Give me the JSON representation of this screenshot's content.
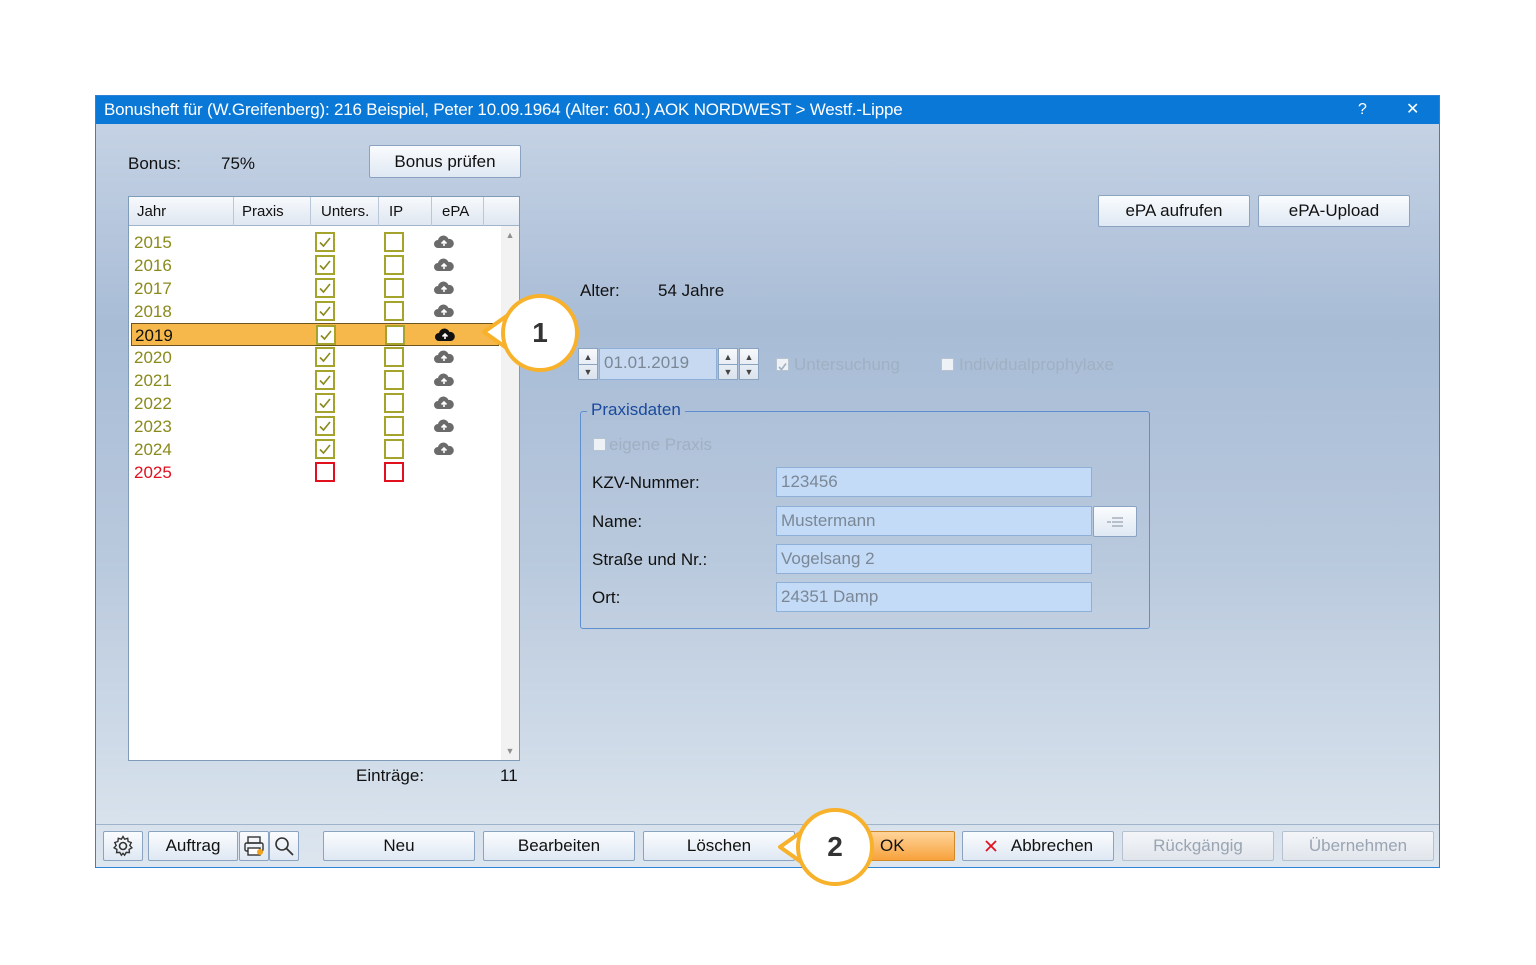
{
  "window": {
    "title": "Bonusheft für (W.Greifenberg): 216  Beispiel, Peter 10.09.1964  (Alter: 60J.)  AOK NORDWEST > Westf.-Lippe",
    "help": "?",
    "close": "✕"
  },
  "bonus": {
    "label": "Bonus:",
    "value": "75%",
    "check_button": "Bonus prüfen"
  },
  "list": {
    "headers": [
      "Jahr",
      "Praxis",
      "Unters.",
      "IP",
      "ePA"
    ],
    "rows": [
      {
        "year": "2015",
        "unters": true,
        "ip": false,
        "epa": true
      },
      {
        "year": "2016",
        "unters": true,
        "ip": false,
        "epa": true
      },
      {
        "year": "2017",
        "unters": true,
        "ip": false,
        "epa": true
      },
      {
        "year": "2018",
        "unters": true,
        "ip": false,
        "epa": true
      },
      {
        "year": "2019",
        "unters": true,
        "ip": false,
        "epa": true,
        "selected": true
      },
      {
        "year": "2020",
        "unters": true,
        "ip": false,
        "epa": true
      },
      {
        "year": "2021",
        "unters": true,
        "ip": false,
        "epa": true
      },
      {
        "year": "2022",
        "unters": true,
        "ip": false,
        "epa": true
      },
      {
        "year": "2023",
        "unters": true,
        "ip": false,
        "epa": true
      },
      {
        "year": "2024",
        "unters": true,
        "ip": false,
        "epa": true
      },
      {
        "year": "2025",
        "unters": false,
        "ip": false,
        "epa": false,
        "missing": true
      }
    ],
    "entries_label": "Einträge:",
    "entries_count": "11"
  },
  "epa": {
    "open_button": "ePA aufrufen",
    "upload_button": "ePA-Upload"
  },
  "detail": {
    "age_label": "Alter:",
    "age_value": "54 Jahre",
    "date": "01.01.2019",
    "untersuchung_label": "Untersuchung",
    "ip_label": "Individualprophylaxe"
  },
  "praxisdaten": {
    "title": "Praxisdaten",
    "own_practice": "eigene Praxis",
    "kzv_label": "KZV-Nummer:",
    "kzv_value": "123456",
    "name_label": "Name:",
    "name_value": "Mustermann",
    "street_label": "Straße und Nr.:",
    "street_value": "Vogelsang 2",
    "city_label": "Ort:",
    "city_value": "24351 Damp"
  },
  "footer": {
    "auftrag": "Auftrag",
    "neu": "Neu",
    "bearbeiten": "Bearbeiten",
    "loeschen": "Löschen",
    "ok": "OK",
    "abbrechen": "Abbrechen",
    "rueckgaengig": "Rückgängig",
    "uebernehmen": "Übernehmen"
  },
  "callouts": {
    "one": "1",
    "two": "2"
  },
  "colors": {
    "accent": "#0a78d7",
    "selection": "#f7b84b",
    "callout": "#f7b12b",
    "checked": "#a4a42c",
    "missing": "#e0101e"
  }
}
